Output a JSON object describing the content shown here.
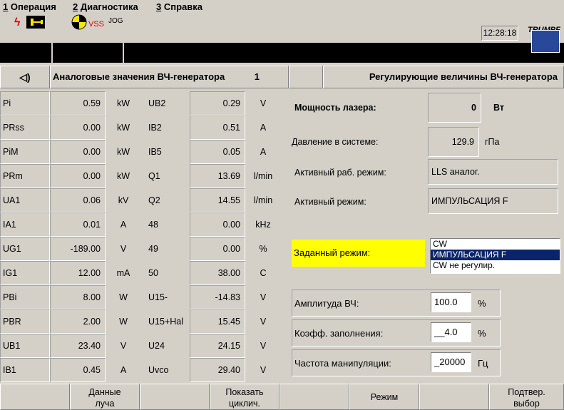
{
  "menu": [
    {
      "num": "1",
      "label": "Операция"
    },
    {
      "num": "2",
      "label": "Диагностика"
    },
    {
      "num": "3",
      "label": "Справка"
    }
  ],
  "status": {
    "vss": "VSS",
    "jog": "JOG",
    "time": "12:28:18",
    "brand": "TRUMPF",
    "colors": {
      "lightning": "#e00000",
      "connector": "#f4e800",
      "vss": "#e00000",
      "brandbox": "#2a4899"
    }
  },
  "left_panel": {
    "title": "Аналоговые значения ВЧ-генератора",
    "page": "1",
    "rows": [
      {
        "l_name": "Pi",
        "l_val": "0.59",
        "l_unit": "kW",
        "r_name": "UB2",
        "r_val": "0.29",
        "r_unit": "V"
      },
      {
        "l_name": "PRss",
        "l_val": "0.00",
        "l_unit": "kW",
        "r_name": "IB2",
        "r_val": "0.51",
        "r_unit": "A"
      },
      {
        "l_name": "PiM",
        "l_val": "0.00",
        "l_unit": "kW",
        "r_name": "IB5",
        "r_val": "0.05",
        "r_unit": "A"
      },
      {
        "l_name": "PRm",
        "l_val": "0.00",
        "l_unit": "kW",
        "r_name": "Q1",
        "r_val": "13.69",
        "r_unit": "l/min"
      },
      {
        "l_name": "UA1",
        "l_val": "0.06",
        "l_unit": "kV",
        "r_name": "Q2",
        "r_val": "14.55",
        "r_unit": "l/min"
      },
      {
        "l_name": "IA1",
        "l_val": "0.01",
        "l_unit": "A",
        "r_name": "48",
        "r_val": "0.00",
        "r_unit": "kHz"
      },
      {
        "l_name": "UG1",
        "l_val": "-189.00",
        "l_unit": "V",
        "r_name": "49",
        "r_val": "0.00",
        "r_unit": "%"
      },
      {
        "l_name": "IG1",
        "l_val": "12.00",
        "l_unit": "mA",
        "r_name": "50",
        "r_val": "38.00",
        "r_unit": "C"
      },
      {
        "l_name": "PBi",
        "l_val": "8.00",
        "l_unit": "W",
        "r_name": "U15-",
        "r_val": "-14.83",
        "r_unit": "V"
      },
      {
        "l_name": "PBR",
        "l_val": "2.00",
        "l_unit": "W",
        "r_name": "U15+Hal",
        "r_val": "15.45",
        "r_unit": "V"
      },
      {
        "l_name": "UB1",
        "l_val": "23.40",
        "l_unit": "V",
        "r_name": "U24",
        "r_val": "24.15",
        "r_unit": "V"
      },
      {
        "l_name": "IB1",
        "l_val": "0.45",
        "l_unit": "A",
        "r_name": "Uvco",
        "r_val": "29.40",
        "r_unit": "V"
      }
    ]
  },
  "right_panel": {
    "title": "Регулирующие величины ВЧ-генератора",
    "laser_power_label": "Мощность лазера:",
    "laser_power_value": "0",
    "laser_power_unit": "Вт",
    "pressure_label": "Давление в системе:",
    "pressure_value": "129.9",
    "pressure_unit": "гПа",
    "active_work_label": "Активный раб. режим:",
    "active_work_value": "LLS аналог.",
    "active_mode_label": "Активный режим:",
    "active_mode_value": "ИМПУЛЬСАЦИЯ F",
    "set_mode_label": "Заданный режим:",
    "set_mode_options": [
      "CW",
      "ИМПУЛЬСАЦИЯ F",
      "CW не регулир."
    ],
    "set_mode_selected": "ИМПУЛЬСАЦИЯ F",
    "amp_label": "Амплитуда ВЧ:",
    "amp_value": "100.0",
    "amp_unit": "%",
    "duty_label": "Коэфф. заполнения:",
    "duty_value": "__4.0",
    "duty_unit": "%",
    "freq_label": "Частота манипуляции:",
    "freq_value": "_20000",
    "freq_unit": "Гц"
  },
  "buttons": [
    {
      "label": ""
    },
    {
      "label": "Данные\nлуча"
    },
    {
      "label": ""
    },
    {
      "label": "Показать\nциклич."
    },
    {
      "label": ""
    },
    {
      "label": "Режим"
    },
    {
      "label": ""
    },
    {
      "label": "Подтвер.\nвыбор"
    }
  ]
}
